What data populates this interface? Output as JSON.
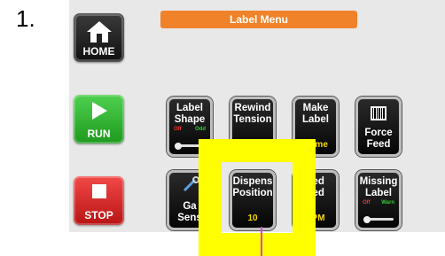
{
  "step": {
    "number": "1."
  },
  "header": {
    "title": "Label Menu"
  },
  "side_buttons": {
    "home": {
      "label": "HOME",
      "icon": "house-icon"
    },
    "run": {
      "label": "RUN",
      "icon": "play-icon"
    },
    "stop": {
      "label": "STOP",
      "icon": "stop-icon"
    }
  },
  "tiles": {
    "label_shape": {
      "line1": "Label",
      "line2": "Shape",
      "off": "Off",
      "on": "Odd"
    },
    "rewind_tension": {
      "line1": "Rewind",
      "line2": "Tension"
    },
    "make_label": {
      "line1": "Make",
      "line2": "Label",
      "sub": "Home"
    },
    "force_feed": {
      "line1": "Force",
      "line2": "Feed",
      "icon": "barcode-icon"
    },
    "gap_sensor": {
      "line1": "Ga",
      "line2": "Sens"
    },
    "dispense_position": {
      "line1": "Dispens",
      "line2": "Position",
      "value": "10"
    },
    "feed_speed": {
      "line1": "eed",
      "line2": "eed",
      "sub": "FPM"
    },
    "missing_label": {
      "line1": "Missing",
      "line2": "Label",
      "off": "Off",
      "on": "Warn"
    }
  },
  "colors": {
    "accent": "#f0822a",
    "run": "#2fb52f",
    "stop": "#e02828",
    "highlight": "#ffff00",
    "value_text": "#f5d800"
  }
}
